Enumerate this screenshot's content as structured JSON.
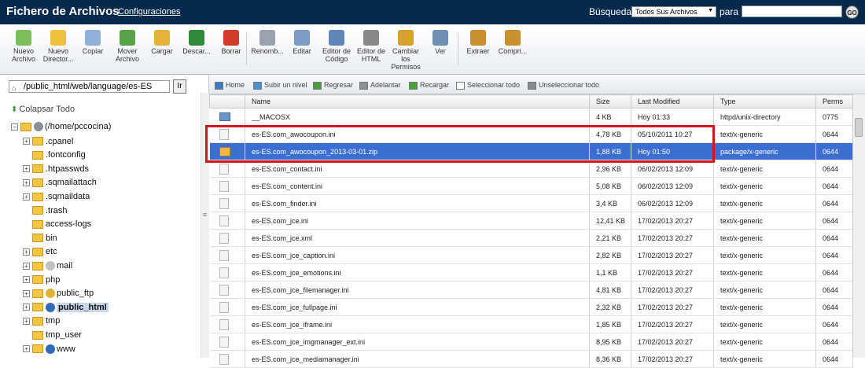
{
  "app": {
    "title": "Fichero de Archivos",
    "config_link": "Configuraciones"
  },
  "search": {
    "label": "Búsqueda",
    "scope": "Todos Sus Archivos",
    "para": "para",
    "value": "",
    "go": "GO"
  },
  "toolbar": [
    {
      "label": "Nuevo Archivo",
      "icon": "new-file-icon",
      "color": "#7cbf5a"
    },
    {
      "label": "Nuevo Director...",
      "icon": "new-folder-icon",
      "color": "#f0c13c"
    },
    {
      "label": "Copiar",
      "icon": "copy-icon",
      "color": "#8fb1d8"
    },
    {
      "label": "Mover Archivo",
      "icon": "move-file-icon",
      "color": "#5aa24a"
    },
    {
      "label": "Cargar",
      "icon": "upload-icon",
      "color": "#e4b33a"
    },
    {
      "label": "Descar...",
      "icon": "download-icon",
      "color": "#2f8a3a"
    },
    {
      "label": "Borrar",
      "icon": "delete-icon",
      "color": "#d23a2a"
    },
    {
      "label": "Renomb...",
      "icon": "rename-icon",
      "color": "#9aa3ad"
    },
    {
      "label": "Editar",
      "icon": "edit-icon",
      "color": "#7d9cc4"
    },
    {
      "label": "Editor de Código",
      "icon": "code-editor-icon",
      "color": "#5f86b8"
    },
    {
      "label": "Editor de HTML",
      "icon": "html-editor-icon",
      "color": "#888888"
    },
    {
      "label": "Cambiar los Permisos",
      "icon": "key-icon",
      "color": "#d8a12a"
    },
    {
      "label": "Ver",
      "icon": "magnifier-icon",
      "color": "#6f8fb3"
    },
    {
      "label": "Extraer",
      "icon": "extract-icon",
      "color": "#c9912e"
    },
    {
      "label": "Compri...",
      "icon": "compress-icon",
      "color": "#c9912e"
    }
  ],
  "path": {
    "value": "/public_html/web/language/es-ES",
    "go": "Ir"
  },
  "collapse_all": "Colapsar Todo",
  "tree": [
    {
      "label": "(/home/pccocina)",
      "expand": "−",
      "extra": "home-icon"
    },
    {
      "label": ".cpanel",
      "expand": "+"
    },
    {
      "label": ".fontconfig",
      "expand": ""
    },
    {
      "label": ".htpasswds",
      "expand": "+"
    },
    {
      "label": ".sqmailattach",
      "expand": "+"
    },
    {
      "label": ".sqmaildata",
      "expand": "+"
    },
    {
      "label": ".trash",
      "expand": ""
    },
    {
      "label": "access-logs",
      "expand": ""
    },
    {
      "label": "bin",
      "expand": ""
    },
    {
      "label": "etc",
      "expand": "+"
    },
    {
      "label": "mail",
      "expand": "+",
      "extra": "mail-icon"
    },
    {
      "label": "php",
      "expand": "+"
    },
    {
      "label": "public_ftp",
      "expand": "+",
      "extra": "ftp-icon"
    },
    {
      "label": "public_html",
      "expand": "+",
      "extra": "globe-icon",
      "selected": true
    },
    {
      "label": "tmp",
      "expand": "+"
    },
    {
      "label": "tmp_user",
      "expand": ""
    },
    {
      "label": "www",
      "expand": "+",
      "extra": "globe-icon"
    }
  ],
  "nav": [
    {
      "label": "Home",
      "icon": "home-nav-icon",
      "color": "#3b7ac6"
    },
    {
      "label": "Subir un nivel",
      "icon": "up-level-icon",
      "color": "#4a8fd0"
    },
    {
      "label": "Regresar",
      "icon": "back-icon",
      "color": "#4aa03a"
    },
    {
      "label": "Adelantar",
      "icon": "forward-icon",
      "color": "#8a9096"
    },
    {
      "label": "Recargar",
      "icon": "reload-icon",
      "color": "#4aa03a"
    },
    {
      "label": "Seleccionar todo",
      "icon": "select-all-icon",
      "color": "#ffffff"
    },
    {
      "label": "Unseleccionar todo",
      "icon": "unselect-all-icon",
      "color": "#8a8a8a"
    }
  ],
  "columns": [
    "",
    "Name",
    "Size",
    "Last Modified",
    "Type",
    "Perms"
  ],
  "files": [
    {
      "name": "__MACOSX",
      "size": "4 KB",
      "modified": "Hoy 01:33",
      "type": "httpd/unix-directory",
      "perms": "0775",
      "kind": "dir"
    },
    {
      "name": "es-ES.com_awocoupon.ini",
      "size": "4,78 KB",
      "modified": "05/10/2011 10:27",
      "type": "text/x-generic",
      "perms": "0644",
      "kind": "file"
    },
    {
      "name": "es-ES.com_awocoupon_2013-03-01.zip",
      "size": "1,88 KB",
      "modified": "Hoy 01:50",
      "type": "package/x-generic",
      "perms": "0644",
      "kind": "zip",
      "selected": true
    },
    {
      "name": "es-ES.com_contact.ini",
      "size": "2,96 KB",
      "modified": "06/02/2013 12:09",
      "type": "text/x-generic",
      "perms": "0644",
      "kind": "file"
    },
    {
      "name": "es-ES.com_content.ini",
      "size": "5,08 KB",
      "modified": "06/02/2013 12:09",
      "type": "text/x-generic",
      "perms": "0644",
      "kind": "file"
    },
    {
      "name": "es-ES.com_finder.ini",
      "size": "3,4 KB",
      "modified": "06/02/2013 12:09",
      "type": "text/x-generic",
      "perms": "0644",
      "kind": "file"
    },
    {
      "name": "es-ES.com_jce.ini",
      "size": "12,41 KB",
      "modified": "17/02/2013 20:27",
      "type": "text/x-generic",
      "perms": "0644",
      "kind": "file"
    },
    {
      "name": "es-ES.com_jce.xml",
      "size": "2,21 KB",
      "modified": "17/02/2013 20:27",
      "type": "text/x-generic",
      "perms": "0644",
      "kind": "file"
    },
    {
      "name": "es-ES.com_jce_caption.ini",
      "size": "2,82 KB",
      "modified": "17/02/2013 20:27",
      "type": "text/x-generic",
      "perms": "0644",
      "kind": "file"
    },
    {
      "name": "es-ES.com_jce_emotions.ini",
      "size": "1,1 KB",
      "modified": "17/02/2013 20:27",
      "type": "text/x-generic",
      "perms": "0644",
      "kind": "file"
    },
    {
      "name": "es-ES.com_jce_filemanager.ini",
      "size": "4,81 KB",
      "modified": "17/02/2013 20:27",
      "type": "text/x-generic",
      "perms": "0644",
      "kind": "file"
    },
    {
      "name": "es-ES.com_jce_fullpage.ini",
      "size": "2,32 KB",
      "modified": "17/02/2013 20:27",
      "type": "text/x-generic",
      "perms": "0644",
      "kind": "file"
    },
    {
      "name": "es-ES.com_jce_iframe.ini",
      "size": "1,85 KB",
      "modified": "17/02/2013 20:27",
      "type": "text/x-generic",
      "perms": "0644",
      "kind": "file"
    },
    {
      "name": "es-ES.com_jce_imgmanager_ext.ini",
      "size": "8,95 KB",
      "modified": "17/02/2013 20:27",
      "type": "text/x-generic",
      "perms": "0644",
      "kind": "file"
    },
    {
      "name": "es-ES.com_jce_mediamanager.ini",
      "size": "8,36 KB",
      "modified": "17/02/2013 20:27",
      "type": "text/x-generic",
      "perms": "0644",
      "kind": "file"
    }
  ]
}
